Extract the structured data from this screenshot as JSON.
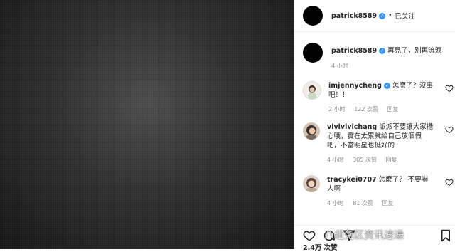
{
  "post": {
    "author": "patrick8589",
    "follow_status": "已关注",
    "separator": "•"
  },
  "caption": {
    "username": "patrick8589",
    "text": "再見了，別再流淚",
    "time": "4 小时"
  },
  "comments": [
    {
      "username": "imjennycheng",
      "verified": true,
      "text": "怎麼了？沒事吧！！",
      "time": "2 小时",
      "likes": "122 次赞",
      "reply": "回复"
    },
    {
      "username": "vivivivichang",
      "verified": false,
      "text": "派派不要讓大家擔心哦，實在太累就給自己放個假吧，不當明星也挺好的",
      "time": "4 小时",
      "likes": "305 次赞",
      "reply": "回复"
    },
    {
      "username": "tracykei0707",
      "verified": false,
      "text": "怎麼了？ 不要嚇人啊",
      "time": "4 小时",
      "likes": "81 次赞",
      "reply": "回复"
    }
  ],
  "footer": {
    "likes_count": "2.4万 次赞"
  },
  "icons": {
    "like": "heart-icon",
    "comment": "comment-icon",
    "share": "share-icon",
    "save": "bookmark-icon"
  },
  "watermark": "八组兔区资讯速递",
  "colors": {
    "verified": "#3897f0",
    "secondary_text": "#8e8e8e",
    "divider": "#efefef"
  }
}
